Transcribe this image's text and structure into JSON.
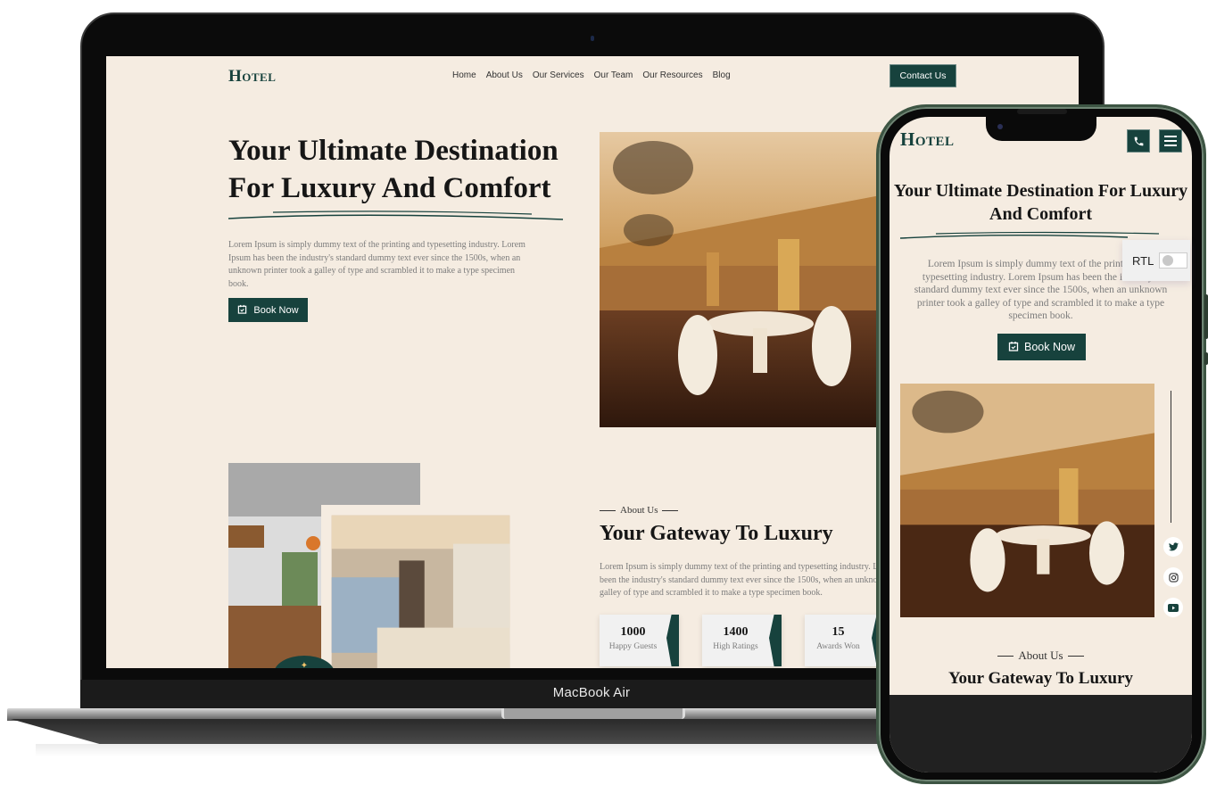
{
  "laptop": {
    "brand_label": "MacBook Air",
    "site": {
      "logo": "Hotel",
      "nav": [
        "Home",
        "About Us",
        "Our Services",
        "Our Team",
        "Our Resources",
        "Blog"
      ],
      "contact_label": "Contact Us",
      "hero": {
        "title": "Your Ultimate Destination For Luxury And Comfort",
        "text": "Lorem Ipsum is simply dummy text of the printing and typesetting industry. Lorem Ipsum has been the industry's standard dummy text ever since the 1500s, when an unknown printer took a galley of type and scrambled it to make a type specimen book.",
        "book_label": "Book Now",
        "image_alt": "Luxury hotel dining room with chandeliers"
      },
      "about": {
        "kicker": "About Us",
        "title": "Your Gateway To Luxury",
        "text_lines": [
          "Lorem Ipsum is simply dummy text of the printing and typesetting industry. Lorem Ipsum has",
          "been the industry's standard dummy text ever since the 1500s, when an unknown printer took a",
          "galley of type and scrambled it to make a type specimen book."
        ],
        "images": [
          "Modern kitchen interior",
          "Luxury bedroom with window"
        ],
        "stats": [
          {
            "value": "1000",
            "label": "Happy Guests"
          },
          {
            "value": "1400",
            "label": "High Ratings"
          },
          {
            "value": "15",
            "label": "Awards Won"
          }
        ]
      }
    }
  },
  "phone": {
    "site": {
      "logo": "Hotel",
      "phone_icon": "phone-icon",
      "menu_icon": "hamburger-menu-icon",
      "hero": {
        "title": "Your Ultimate Destination For Luxury And Comfort",
        "text": "Lorem Ipsum is simply dummy text of the printing and typesetting industry. Lorem Ipsum has been the industry's standard dummy text ever since the 1500s, when an unknown printer took a galley of type and scrambled it to make a type specimen book.",
        "book_label": "Book Now"
      },
      "social": [
        "twitter-icon",
        "instagram-icon",
        "youtube-icon"
      ],
      "about": {
        "kicker": "About Us",
        "title": "Your Gateway To Luxury"
      }
    },
    "rtl_toggle": {
      "label": "RTL",
      "enabled": false
    }
  },
  "colors": {
    "brand": "#17423d",
    "page_bg": "#f5ece1",
    "text_dark": "#161616",
    "text_muted": "#7c7c7c"
  }
}
